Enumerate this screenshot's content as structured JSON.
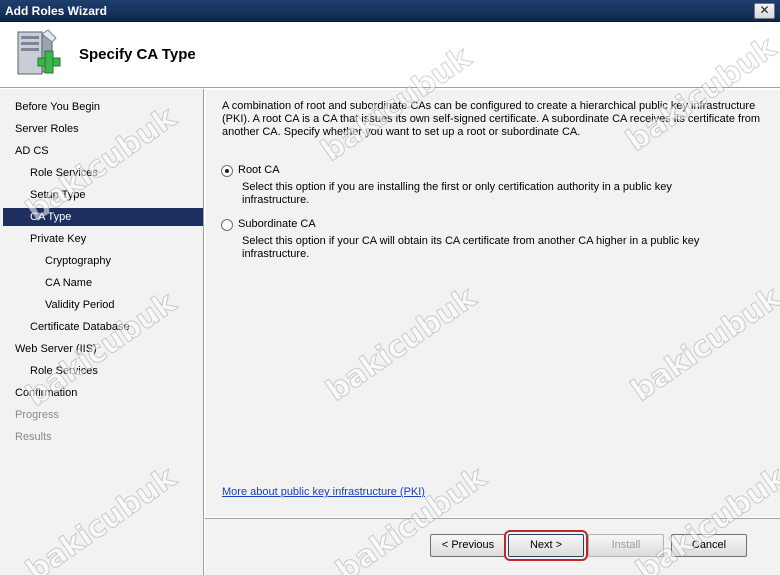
{
  "window": {
    "title": "Add Roles Wizard",
    "close_glyph": "✕"
  },
  "header": {
    "page_title": "Specify CA Type"
  },
  "nav": {
    "items": [
      {
        "label": "Before You Begin"
      },
      {
        "label": "Server Roles"
      },
      {
        "label": "AD CS"
      },
      {
        "label": "Role Services"
      },
      {
        "label": "Setup Type"
      },
      {
        "label": "CA Type"
      },
      {
        "label": "Private Key"
      },
      {
        "label": "Cryptography"
      },
      {
        "label": "CA Name"
      },
      {
        "label": "Validity Period"
      },
      {
        "label": "Certificate Database"
      },
      {
        "label": "Web Server (IIS)"
      },
      {
        "label": "Role Services"
      },
      {
        "label": "Confirmation"
      },
      {
        "label": "Progress"
      },
      {
        "label": "Results"
      }
    ]
  },
  "main": {
    "intro": "A combination of root and subordinate CAs can be configured to create a hierarchical public key infrastructure (PKI). A root CA is a CA that issues its own self-signed certificate. A subordinate CA receives its certificate from another CA. Specify whether you want to set up a root or subordinate CA.",
    "options": [
      {
        "label": "Root CA",
        "checked": true,
        "description": "Select this option if you are installing the first or only certification authority in a public key infrastructure."
      },
      {
        "label": "Subordinate CA",
        "checked": false,
        "description": "Select this option if your CA will obtain its CA certificate from another CA higher in a public key infrastructure."
      }
    ],
    "help_link": "More about public key infrastructure (PKI)"
  },
  "buttons": {
    "previous": "< Previous",
    "next": "Next >",
    "install": "Install",
    "cancel": "Cancel"
  },
  "watermark": "bakicubuk",
  "colors": {
    "selected_nav": "#1c2f5e",
    "titlebar": "#16325c",
    "link": "#1a3fbf",
    "highlight": "#c0262a"
  }
}
